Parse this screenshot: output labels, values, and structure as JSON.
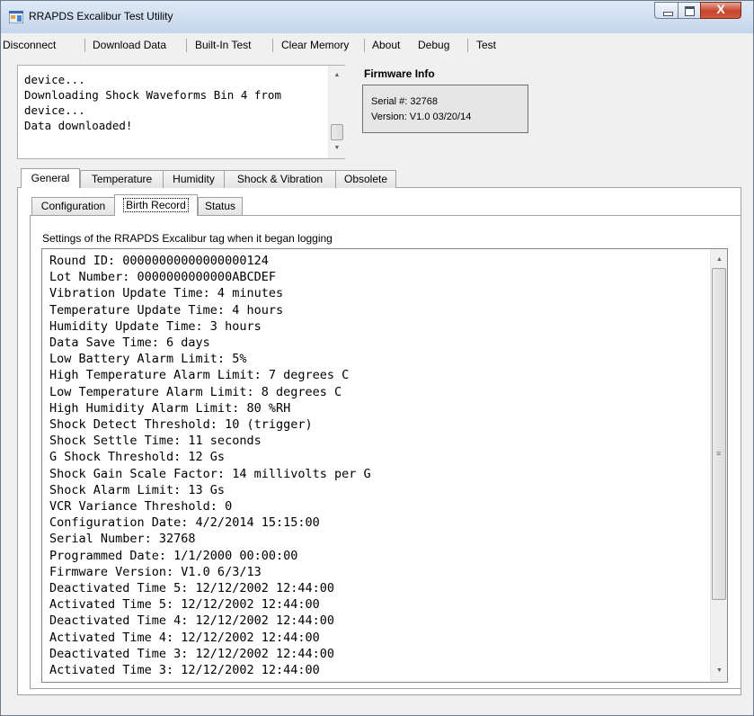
{
  "window": {
    "title": "RRAPDS Excalibur Test Utility",
    "icon": "app-window-icon",
    "controls": {
      "minimize_icon": "minimize-icon",
      "maximize_icon": "maximize-icon",
      "close_icon": "close-icon",
      "close_glyph": "X"
    }
  },
  "menu": {
    "items": [
      "Disconnect",
      "Download Data",
      "Built-In Test",
      "Clear Memory",
      "About",
      "Debug",
      "Test"
    ]
  },
  "log": {
    "lines": [
      "device...",
      "Downloading Shock Waveforms Bin 4 from",
      "device...",
      "Data downloaded!"
    ],
    "scroll_up": "▲",
    "scroll_down": "▼"
  },
  "firmware": {
    "title": "Firmware Info",
    "serial": "Serial #:  32768",
    "version": "Version:  V1.0 03/20/14"
  },
  "tabs": {
    "items": [
      "General",
      "Temperature",
      "Humidity",
      "Shock & Vibration",
      "Obsolete"
    ],
    "active": "General"
  },
  "subtabs": {
    "items": [
      "Configuration",
      "Birth Record",
      "Status"
    ],
    "active": "Birth Record"
  },
  "birth_record": {
    "caption": "Settings of the RRAPDS Excalibur tag when it began logging",
    "lines": [
      "Round ID: 00000000000000000124",
      "Lot Number: 0000000000000ABCDEF",
      "Vibration Update Time: 4 minutes",
      "Temperature Update Time: 4 hours",
      "Humidity Update Time: 3 hours",
      "Data Save Time: 6 days",
      "Low Battery Alarm Limit: 5%",
      "High Temperature Alarm Limit: 7 degrees C",
      "Low Temperature Alarm Limit: 8 degrees C",
      "High Humidity Alarm Limit: 80 %RH",
      "Shock Detect Threshold: 10 (trigger)",
      "Shock Settle Time: 11 seconds",
      "G Shock Threshold: 12 Gs",
      "Shock Gain Scale Factor: 14 millivolts per G",
      "Shock Alarm Limit: 13 Gs",
      "VCR Variance Threshold: 0",
      "Configuration Date: 4/2/2014 15:15:00",
      "Serial Number: 32768",
      "Programmed Date: 1/1/2000 00:00:00",
      "Firmware Version: V1.0 6/3/13",
      "Deactivated Time 5: 12/12/2002 12:44:00",
      "Activated Time 5: 12/12/2002 12:44:00",
      "Deactivated Time 4: 12/12/2002 12:44:00",
      "Activated Time 4: 12/12/2002 12:44:00",
      "Deactivated Time 3: 12/12/2002 12:44:00",
      "Activated Time 3: 12/12/2002 12:44:00"
    ],
    "scroll_up": "▲",
    "scroll_down": "▼",
    "grip": "≡"
  }
}
